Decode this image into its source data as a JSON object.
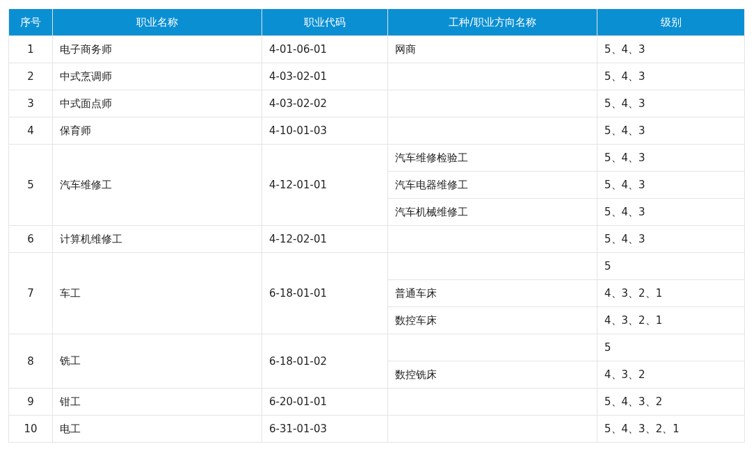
{
  "table": {
    "columns": [
      "序号",
      "职业名称",
      "职业代码",
      "工种/职业方向名称",
      "级别"
    ],
    "rows": [
      {
        "number": "1",
        "occupation": "电子商务师",
        "code": "4-01-06-01",
        "directions": [
          {
            "name": "网商",
            "levels": "5、4、3"
          }
        ]
      },
      {
        "number": "2",
        "occupation": "中式烹调师",
        "code": "4-03-02-01",
        "directions": [
          {
            "levels": "5、4、3"
          }
        ]
      },
      {
        "number": "3",
        "occupation": "中式面点师",
        "code": "4-03-02-02",
        "directions": [
          {
            "levels": "5、4、3"
          }
        ]
      },
      {
        "number": "4",
        "occupation": "保育师",
        "code": "4-10-01-03",
        "directions": [
          {
            "levels": "5、4、3"
          }
        ]
      },
      {
        "number": "5",
        "occupation": "汽车维修工",
        "code": "4-12-01-01",
        "directions": [
          {
            "name": "汽车维修检验工",
            "levels": "5、4、3"
          },
          {
            "name": "汽车电器维修工",
            "levels": "5、4、3"
          },
          {
            "name": "汽车机械维修工",
            "levels": "5、4、3"
          }
        ]
      },
      {
        "number": "6",
        "occupation": "计算机维修工",
        "code": "4-12-02-01",
        "directions": [
          {
            "levels": "5、4、3"
          }
        ]
      },
      {
        "number": "7",
        "occupation": "车工",
        "code": "6-18-01-01",
        "directions": [
          {
            "levels": "5"
          },
          {
            "name": "普通车床",
            "levels": "4、3、2、1"
          },
          {
            "name": "数控车床",
            "levels": "4、3、2、1"
          }
        ]
      },
      {
        "number": "8",
        "occupation": "铣工",
        "code": "6-18-01-02",
        "directions": [
          {
            "levels": "5"
          },
          {
            "name": "数控铣床",
            "levels": "4、3、2"
          }
        ]
      },
      {
        "number": "9",
        "occupation": "钳工",
        "code": "6-20-01-01",
        "directions": [
          {
            "levels": "5、4、3、2"
          }
        ]
      },
      {
        "number": "10",
        "occupation": "电工",
        "code": "6-31-01-03",
        "directions": [
          {
            "levels": "5、4、3、2、1"
          }
        ]
      }
    ]
  }
}
